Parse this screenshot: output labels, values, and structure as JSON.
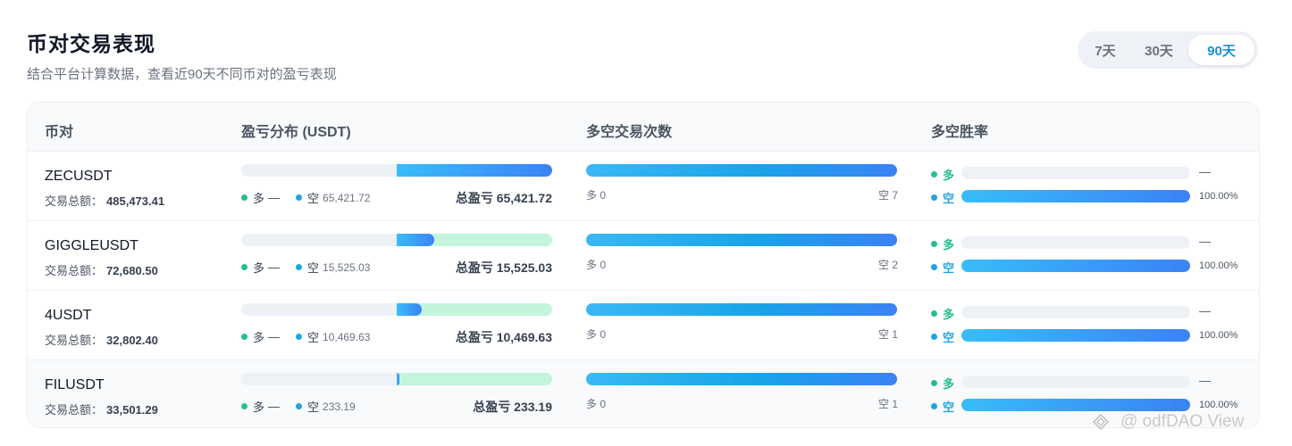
{
  "header": {
    "title": "币对交易表现",
    "subtitle": "结合平台计算数据，查看近90天不同币对的盈亏表现"
  },
  "range": {
    "options": [
      "7天",
      "30天",
      "90天"
    ],
    "selected": "90天"
  },
  "table": {
    "headers": {
      "pair": "币对",
      "pnl": "盈亏分布 (USDT)",
      "count": "多空交易次数",
      "winrate": "多空胜率"
    },
    "volume_label": "交易总额：",
    "long_label": "多",
    "short_label": "空",
    "rows": [
      {
        "symbol": "ZECUSDT",
        "volume": "485,473.41",
        "long_pnl": "—",
        "short_pnl": "65,421.72",
        "total_pnl": "总盈亏 65,421.72",
        "short_pnl_share": 1.0,
        "long_count": "多 0",
        "short_count": "空 7",
        "long_winrate": "—",
        "short_winrate": "100.00%",
        "long_winrate_pct": 0,
        "short_winrate_pct": 100
      },
      {
        "symbol": "GIGGLEUSDT",
        "volume": "72,680.50",
        "long_pnl": "—",
        "short_pnl": "15,525.03",
        "total_pnl": "总盈亏 15,525.03",
        "short_pnl_share": 0.24,
        "long_count": "多 0",
        "short_count": "空 2",
        "long_winrate": "—",
        "short_winrate": "100.00%",
        "long_winrate_pct": 0,
        "short_winrate_pct": 100
      },
      {
        "symbol": "4USDT",
        "volume": "32,802.40",
        "long_pnl": "—",
        "short_pnl": "10,469.63",
        "total_pnl": "总盈亏 10,469.63",
        "short_pnl_share": 0.16,
        "long_count": "多 0",
        "short_count": "空 1",
        "long_winrate": "—",
        "short_winrate": "100.00%",
        "long_winrate_pct": 0,
        "short_winrate_pct": 100
      },
      {
        "symbol": "FILUSDT",
        "volume": "33,501.29",
        "long_pnl": "—",
        "short_pnl": "233.19",
        "total_pnl": "总盈亏 233.19",
        "short_pnl_share": 0.01,
        "long_count": "多 0",
        "short_count": "空 1",
        "long_winrate": "—",
        "short_winrate": "100.00%",
        "long_winrate_pct": 0,
        "short_winrate_pct": 100
      }
    ]
  },
  "watermark": {
    "text": "@  odfDAO View",
    "icon": "binance-square-logo-icon"
  },
  "colors": {
    "accent": "#1a8fd6",
    "long": "#22c08a",
    "short": "#1ea4e4",
    "bar_gradient_start": "#38bdf8",
    "bar_gradient_end": "#3b82f6",
    "pnl_positive_bg": "#c2f5dc"
  }
}
